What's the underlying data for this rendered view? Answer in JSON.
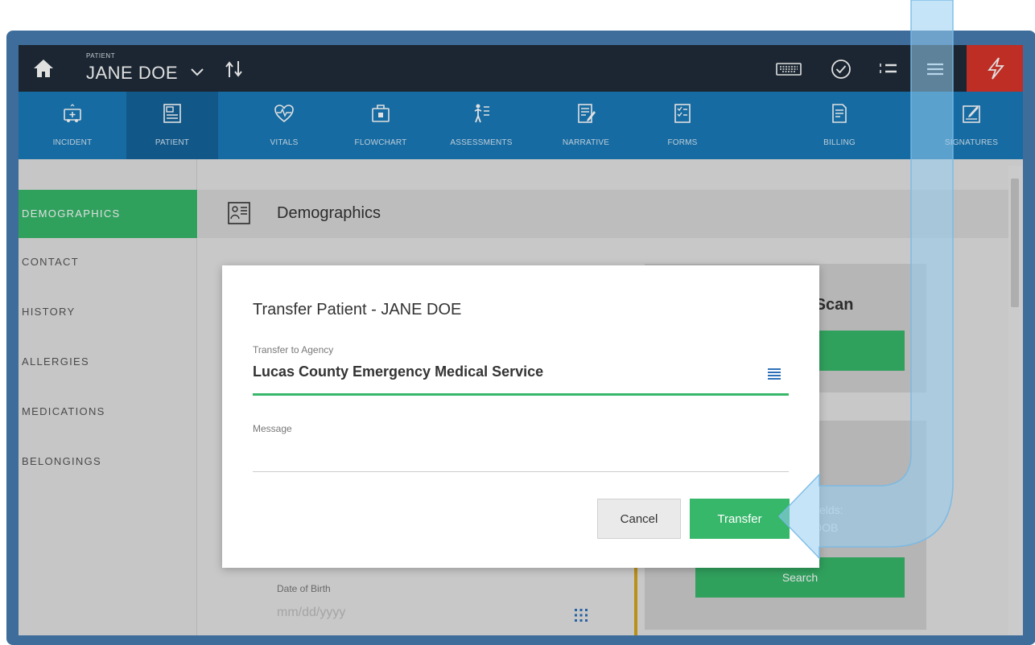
{
  "topbar": {
    "patient_label": "PATIENT",
    "patient_name": "JANE DOE"
  },
  "nav": [
    {
      "label": "INCIDENT",
      "icon": "ambulance-icon"
    },
    {
      "label": "PATIENT",
      "icon": "patient-chart-icon",
      "active": true
    },
    {
      "label": "VITALS",
      "icon": "heart-pulse-icon"
    },
    {
      "label": "FLOWCHART",
      "icon": "kit-icon"
    },
    {
      "label": "ASSESSMENTS",
      "icon": "body-icon"
    },
    {
      "label": "NARRATIVE",
      "icon": "document-pen-icon"
    },
    {
      "label": "FORMS",
      "icon": "checklist-icon"
    },
    {
      "label": "BILLING",
      "icon": "invoice-icon"
    },
    {
      "label": "SIGNATURES",
      "icon": "signature-icon"
    }
  ],
  "sidebar": {
    "items": [
      {
        "label": "DEMOGRAPHICS",
        "active": true
      },
      {
        "label": "CONTACT"
      },
      {
        "label": "HISTORY"
      },
      {
        "label": "ALLERGIES"
      },
      {
        "label": "MEDICATIONS"
      },
      {
        "label": "BELONGINGS"
      }
    ]
  },
  "main": {
    "section_title": "Demographics",
    "scan_title_fragment": "e Scan",
    "fields_label_fragment_1": "fields:",
    "fields_label_fragment_2": "DOB",
    "search_label": "Search",
    "dob_label": "Date of Birth",
    "dob_placeholder": "mm/dd/yyyy"
  },
  "modal": {
    "title": "Transfer Patient - JANE DOE",
    "agency_label": "Transfer to Agency",
    "agency_value": "Lucas County Emergency Medical Service",
    "message_label": "Message",
    "message_value": "",
    "cancel_label": "Cancel",
    "transfer_label": "Transfer"
  },
  "colors": {
    "topbar": "#1f2c3a",
    "navbar": "#1a7ab9",
    "accent_green": "#37b76a",
    "alert_red": "#d9352b",
    "frame": "#3f6d9b"
  }
}
